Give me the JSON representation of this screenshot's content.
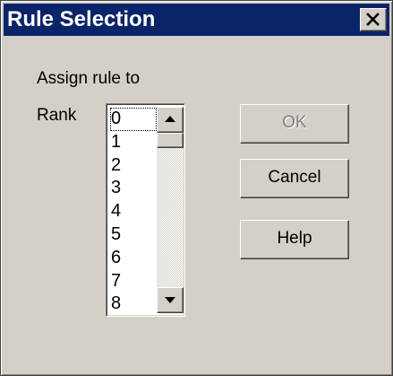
{
  "window": {
    "title": "Rule Selection",
    "close_label": "×"
  },
  "form": {
    "assign_label": "Assign rule to",
    "rank_label": "Rank"
  },
  "rank_list": {
    "items": [
      "0",
      "1",
      "2",
      "3",
      "4",
      "5",
      "6",
      "7",
      "8"
    ],
    "selected": "0"
  },
  "buttons": {
    "ok": "OK",
    "cancel": "Cancel",
    "help": "Help"
  },
  "colors": {
    "titlebar": "#0a246a",
    "face": "#d4d0c8",
    "disabled_text": "#808080"
  },
  "icons": {
    "close": "close-icon",
    "scroll_up": "arrow-up-icon",
    "scroll_down": "arrow-down-icon"
  }
}
